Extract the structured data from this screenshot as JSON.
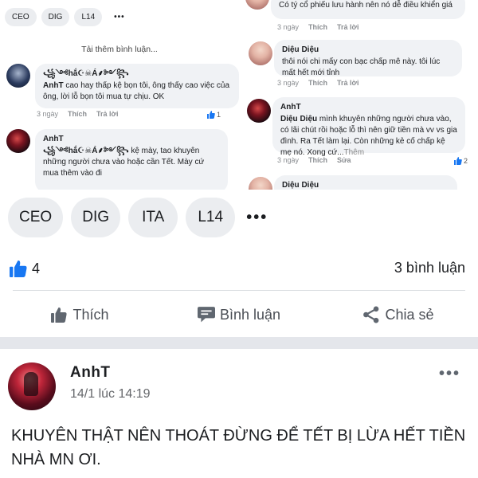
{
  "collage_left": {
    "mini_tags": [
      "CEO",
      "DIG",
      "L14"
    ],
    "mini_dots": "•••",
    "load_more": "Tải thêm bình luận...",
    "comments": [
      {
        "name": "꧁༺hắ☪☠Á⸙༻꧂",
        "text_author": "AnhT",
        "text": " cao hay thấp kệ bọn tôi, ông thấy cao việc của ông, lời lỗ bọn tôi mua tự chịu. OK",
        "time": "3 ngày",
        "like": "Thích",
        "reply": "Trả lời",
        "reactions": "1"
      },
      {
        "name": "AnhT",
        "text_author": "꧁༺hắ☪☠Á⸙༻꧂",
        "text": " kệ mày, tao khuyên những người chưa vào hoặc cần Tết. Mày cứ mua thêm vào đi"
      }
    ]
  },
  "collage_right": {
    "top_text": "Có tý cổ phiếu lưu hành nên nó dễ điều khiển giá",
    "top_time": "3 ngày",
    "top_like": "Thích",
    "top_reply": "Trả lời",
    "comments": [
      {
        "name": "Diệu Diệu",
        "text": "thôi nói chi mấy con bạc chấp mê này. tôi lúc mất hết mới tỉnh",
        "time": "3 ngày",
        "like": "Thích",
        "reply": "Trả lời"
      },
      {
        "name": "AnhT",
        "text_author": "Diệu Diệu",
        "text": " mình khuyên những người chưa vào, có lãi chút rồi hoặc lỗ thì nên giữ tiền mà vv vs gia đình. Ra Tết làm lại. Còn những kẻ cố chấp kệ mẹ nó. Xong cứ...",
        "more": "Thêm",
        "time": "3 ngày",
        "like": "Thích",
        "edit": "Sửa",
        "reactions": "2"
      },
      {
        "name": "Diệu Diệu"
      }
    ]
  },
  "tags": [
    "CEO",
    "DIG",
    "ITA",
    "L14"
  ],
  "tags_more": "•••",
  "summary": {
    "likes": "4",
    "comments": "3 bình luận"
  },
  "actions": {
    "like": "Thích",
    "comment": "Bình luận",
    "share": "Chia sẻ"
  },
  "post": {
    "author": "AnhT",
    "time": "14/1 lúc 14:19",
    "menu": "•••",
    "text": "KHUYÊN THẬT NÊN THOÁT ĐỪNG ĐỂ TẾT BỊ LỪA HẾT TIỀN NHÀ MN ƠI."
  },
  "colors": {
    "accent": "#1877f2",
    "bubble": "#f0f2f5",
    "separator": "#e4e6eb"
  }
}
